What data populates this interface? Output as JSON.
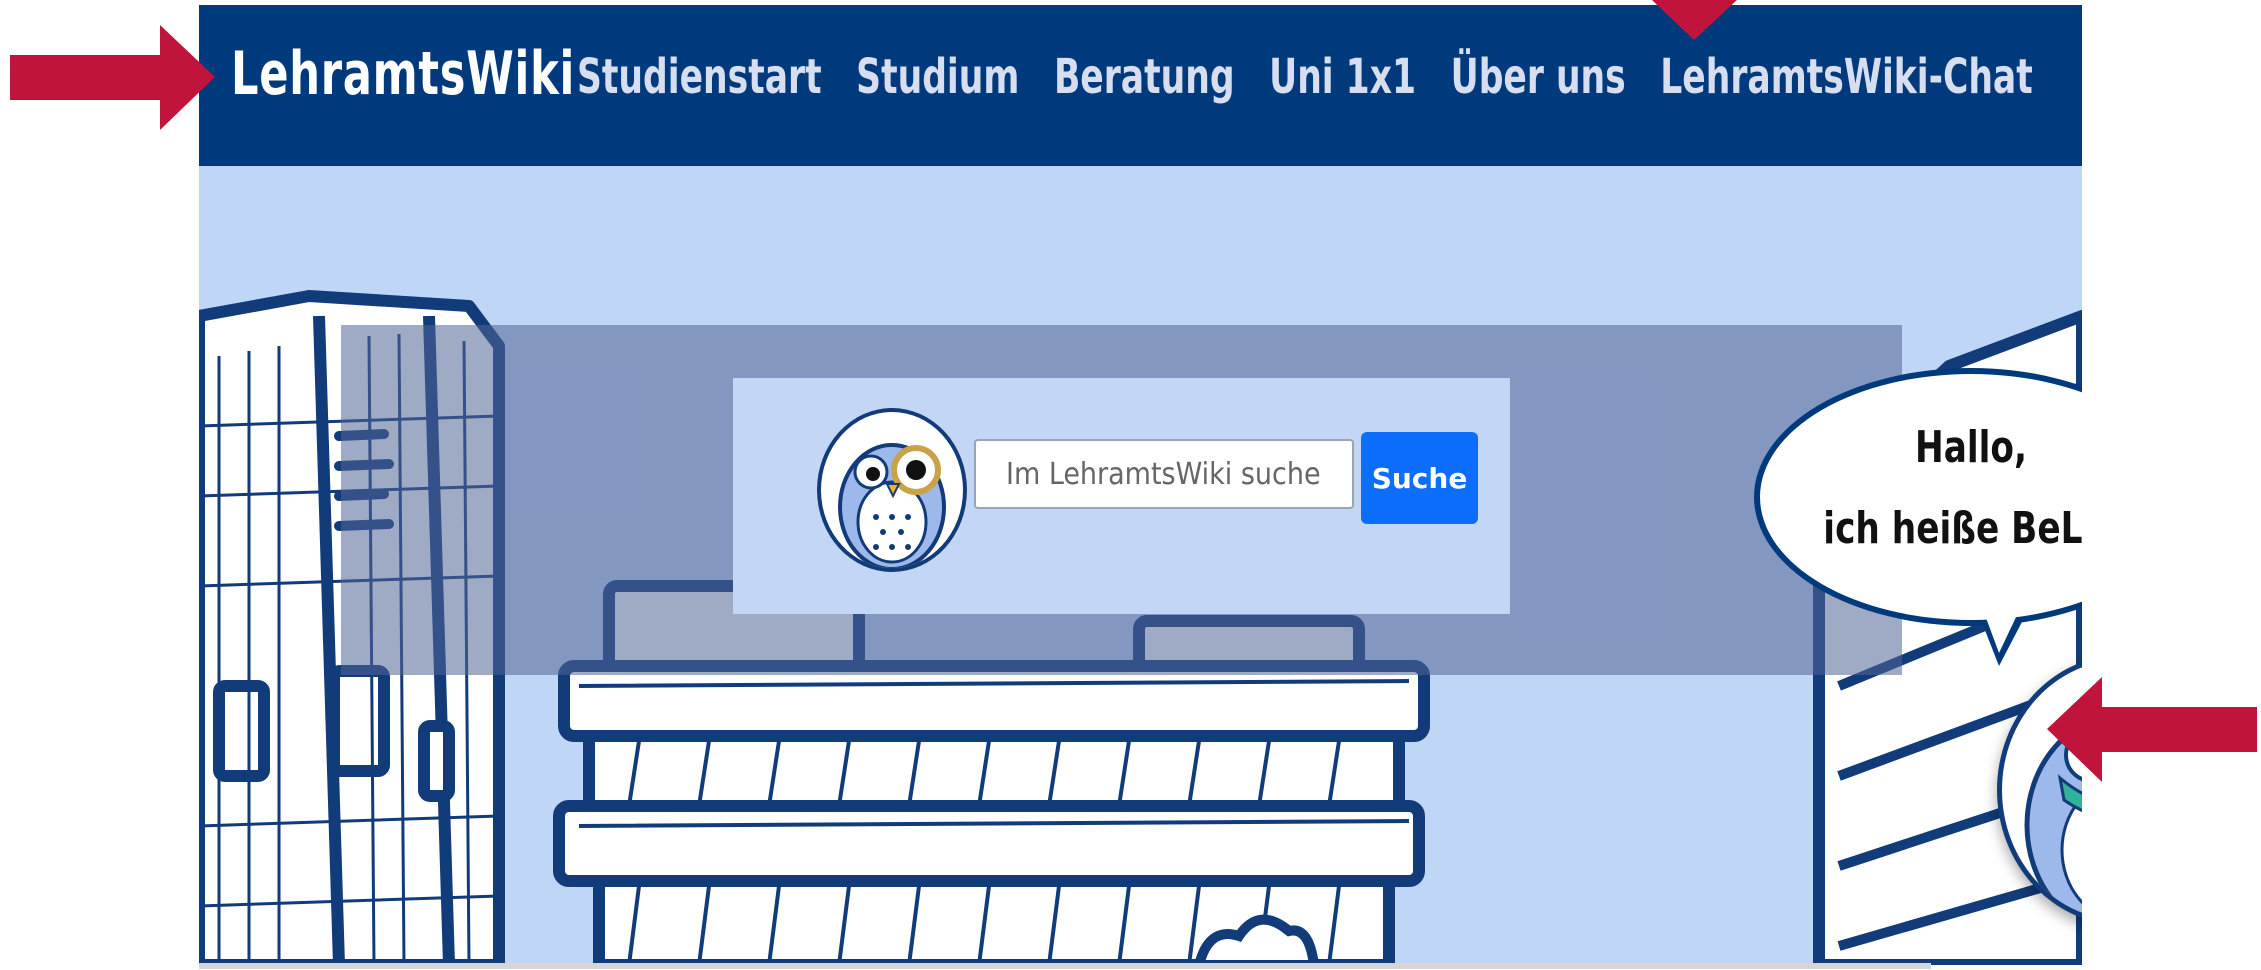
{
  "navbar": {
    "brand": "LehramtsWiki",
    "items": [
      {
        "label": "Studienstart"
      },
      {
        "label": "Studium"
      },
      {
        "label": "Beratung"
      },
      {
        "label": "Uni 1x1"
      },
      {
        "label": "Über uns"
      },
      {
        "label": "LehramtsWiki-Chat"
      }
    ]
  },
  "search": {
    "placeholder": "Im LehramtsWiki suchen...",
    "button_label": "Suche"
  },
  "chatbot": {
    "greeting_line1": "Hallo,",
    "greeting_line2": "ich heiße BeLa.",
    "close_symbol": "×"
  },
  "colors": {
    "navbar": "#003a7d",
    "hero_bg": "#c0d6f7",
    "button": "#0d6efd",
    "annotation_arrow": "#c0143c"
  },
  "icons": [
    "owl-magnifier-icon",
    "bela-owl-icon",
    "close-icon",
    "annotation-arrow-icon"
  ]
}
